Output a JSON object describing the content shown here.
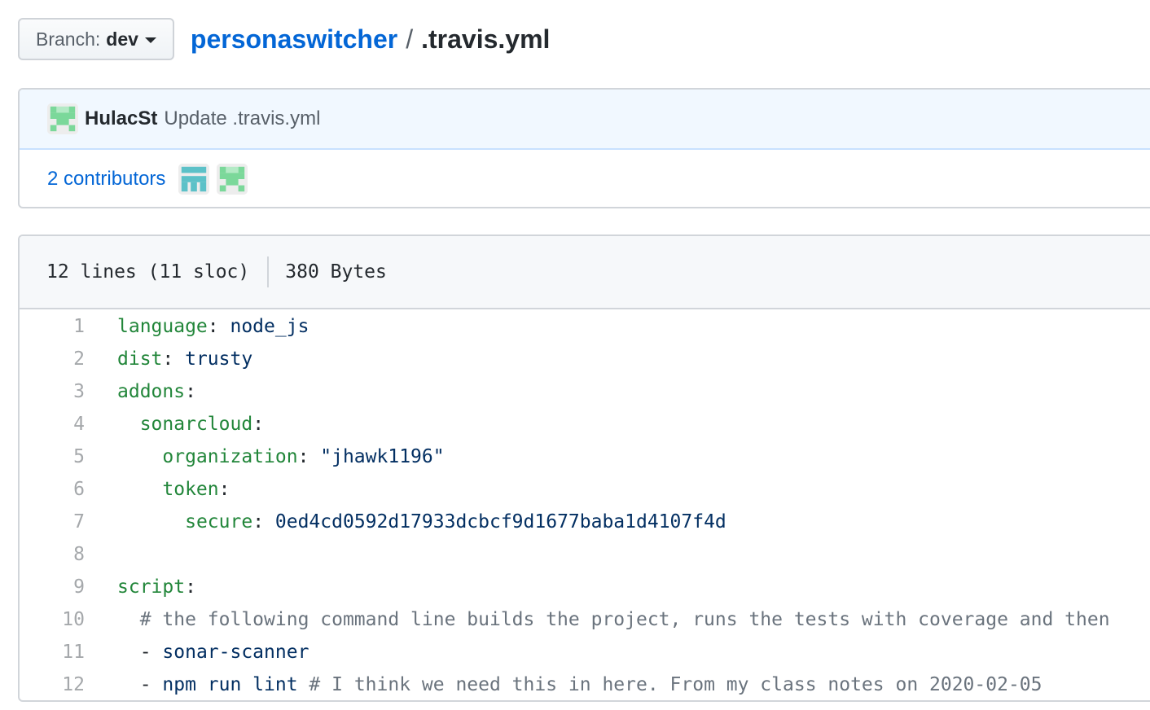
{
  "branch": {
    "label": "Branch:",
    "value": "dev"
  },
  "breadcrumb": {
    "repo": "personaswitcher",
    "separator": "/",
    "file": ".travis.yml"
  },
  "commit": {
    "author": "HulacSt",
    "message": "Update .travis.yml"
  },
  "contributors": {
    "label": "2 contributors"
  },
  "file_info": {
    "lines": "12 lines (11 sloc)",
    "size": "380 Bytes"
  },
  "code_lines": [
    {
      "num": "1",
      "indent": "",
      "key": "language",
      "colon": ": ",
      "value": "node_js",
      "comment": ""
    },
    {
      "num": "2",
      "indent": "",
      "key": "dist",
      "colon": ": ",
      "value": "trusty",
      "comment": ""
    },
    {
      "num": "3",
      "indent": "",
      "key": "addons",
      "colon": ":",
      "value": "",
      "comment": ""
    },
    {
      "num": "4",
      "indent": "  ",
      "key": "sonarcloud",
      "colon": ":",
      "value": "",
      "comment": ""
    },
    {
      "num": "5",
      "indent": "    ",
      "key": "organization",
      "colon": ": ",
      "value": "\"jhawk1196\"",
      "comment": ""
    },
    {
      "num": "6",
      "indent": "    ",
      "key": "token",
      "colon": ":",
      "value": "",
      "comment": ""
    },
    {
      "num": "7",
      "indent": "      ",
      "key": "secure",
      "colon": ": ",
      "value": "0ed4cd0592d17933dcbcf9d1677baba1d4107f4d",
      "comment": ""
    },
    {
      "num": "8",
      "indent": "",
      "key": "",
      "colon": "",
      "value": "",
      "comment": ""
    },
    {
      "num": "9",
      "indent": "",
      "key": "script",
      "colon": ":",
      "value": "",
      "comment": ""
    },
    {
      "num": "10",
      "indent": "  ",
      "key": "",
      "colon": "",
      "value": "",
      "comment": "# the following command line builds the project, runs the tests with coverage and then"
    },
    {
      "num": "11",
      "indent": "  ",
      "key": "",
      "colon": "- ",
      "value": "sonar-scanner",
      "comment": ""
    },
    {
      "num": "12",
      "indent": "  ",
      "key": "",
      "colon": "- ",
      "value": "npm run lint",
      "comment": " # I think we need this in here. From my class notes on 2020-02-05"
    }
  ]
}
